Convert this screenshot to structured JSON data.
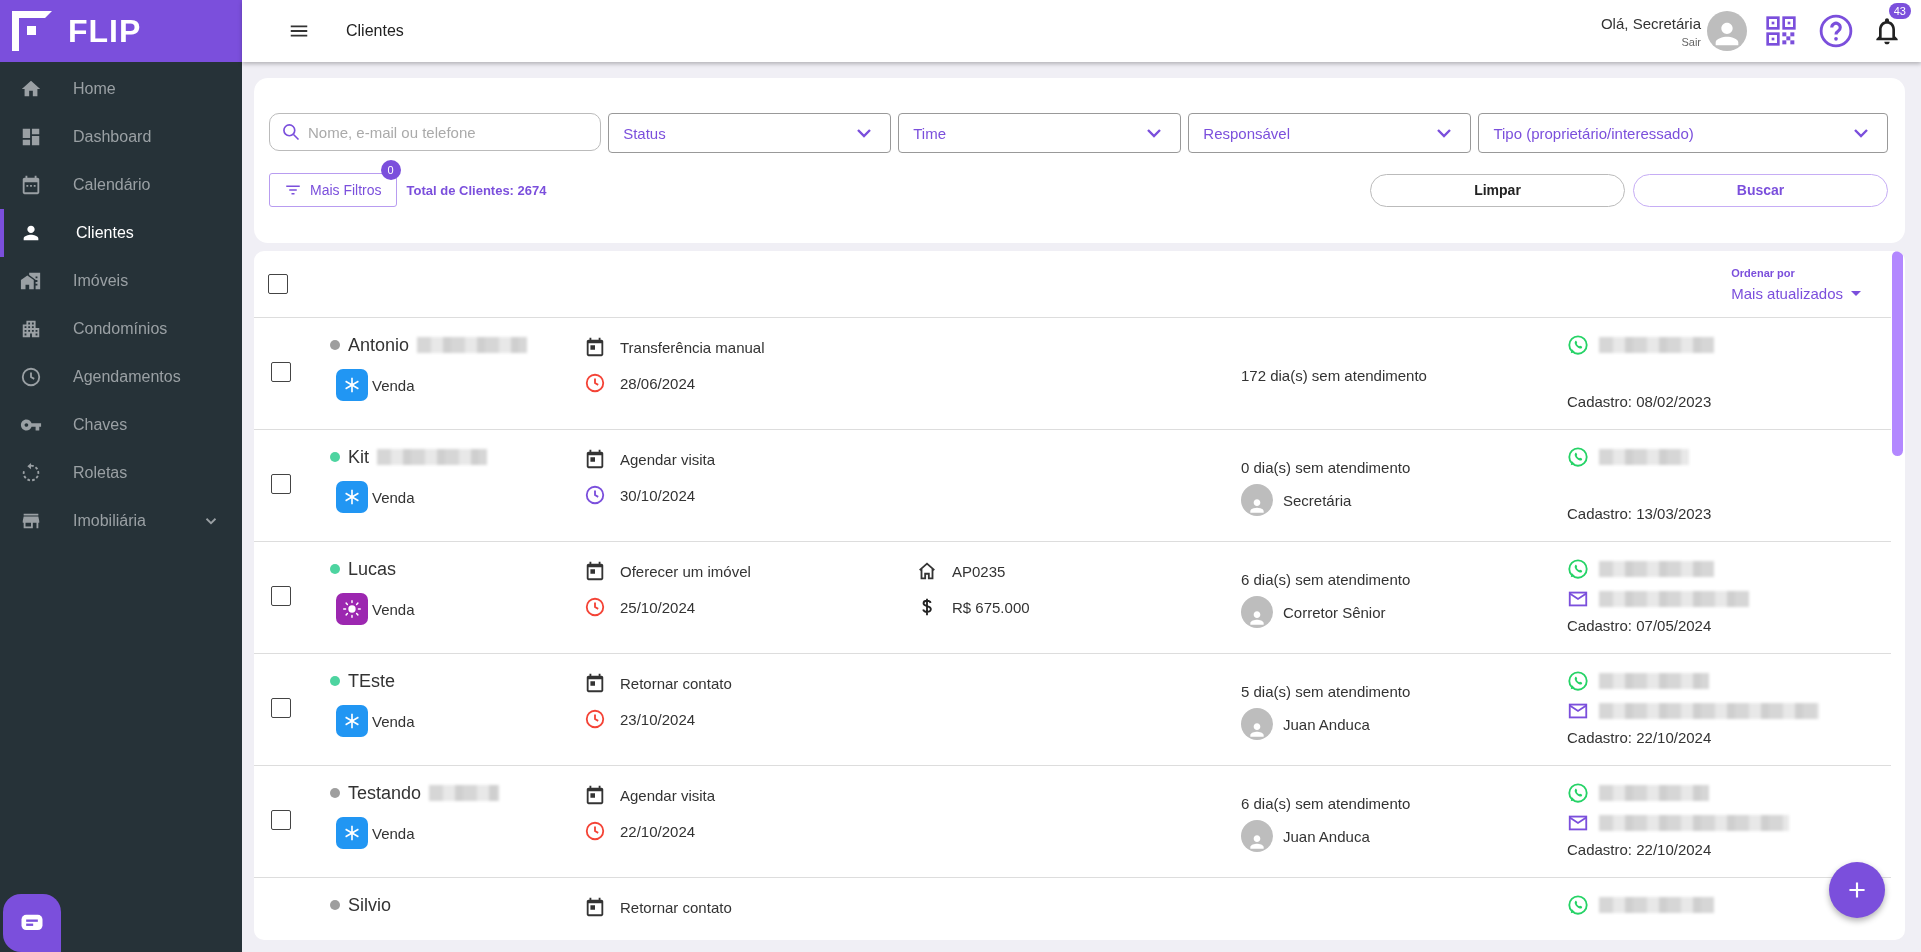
{
  "brand": {
    "name": "FLIP"
  },
  "sidebar": {
    "items": [
      {
        "label": "Home",
        "selected": false
      },
      {
        "label": "Dashboard",
        "selected": false
      },
      {
        "label": "Calendário",
        "selected": false
      },
      {
        "label": "Clientes",
        "selected": true
      },
      {
        "label": "Imóveis",
        "selected": false
      },
      {
        "label": "Condomínios",
        "selected": false
      },
      {
        "label": "Agendamentos",
        "selected": false
      },
      {
        "label": "Chaves",
        "selected": false
      },
      {
        "label": "Roletas",
        "selected": false
      },
      {
        "label": "Imobiliária",
        "selected": false,
        "expanded": false
      }
    ]
  },
  "header": {
    "title": "Clientes",
    "greeting": "Olá, Secretária",
    "logout": "Sair",
    "notifications": "43"
  },
  "filters": {
    "search": {
      "placeholder": "Nome, e-mail ou telefone"
    },
    "selects": [
      {
        "label": "Status"
      },
      {
        "label": "Time"
      },
      {
        "label": "Responsável"
      },
      {
        "label": "Tipo (proprietário/interessado)"
      }
    ],
    "more_filters": {
      "label": "Mais Filtros",
      "count": "0"
    },
    "total": "Total de Clientes: 2674",
    "buttons": [
      {
        "label": "Limpar",
        "kind": "plain"
      },
      {
        "label": "Buscar",
        "kind": "primary"
      }
    ]
  },
  "list": {
    "select_all": {
      "checked": false
    },
    "sort": {
      "label": "Ordenar por",
      "value": "Mais atualizados"
    },
    "rows": [
      {
        "name": "Antonio",
        "name_blurred": true,
        "active": false,
        "checked": false,
        "deal": {
          "label": "Venda",
          "kind": "cold"
        },
        "activity": "Transferência manual",
        "date": "28/06/2024",
        "overdue": true,
        "days": "172 dia(s) sem atendimento",
        "contacts": [
          {
            "kind": "whatsapp"
          }
        ],
        "registered": "Cadastro: 08/02/2023"
      },
      {
        "name": "Kit",
        "name_blurred": true,
        "active": true,
        "checked": false,
        "deal": {
          "label": "Venda",
          "kind": "cold"
        },
        "activity": "Agendar visita",
        "date": "30/10/2024",
        "overdue": false,
        "days": "0 dia(s) sem atendimento",
        "agent": "Secretária",
        "contacts": [
          {
            "kind": "whatsapp"
          }
        ],
        "registered": "Cadastro: 13/03/2023"
      },
      {
        "name": "Lucas",
        "name_blurred": false,
        "active": true,
        "checked": false,
        "deal": {
          "label": "Venda",
          "kind": "hot"
        },
        "activity": "Oferecer um imóvel",
        "date": "25/10/2024",
        "overdue": true,
        "property": {
          "code": "AP0235",
          "price": "R$ 675.000"
        },
        "days": "6 dia(s) sem atendimento",
        "agent": "Corretor Sênior",
        "contacts": [
          {
            "kind": "whatsapp"
          },
          {
            "kind": "email"
          }
        ],
        "registered": "Cadastro: 07/05/2024"
      },
      {
        "name": "TEste",
        "name_blurred": false,
        "active": true,
        "checked": false,
        "deal": {
          "label": "Venda",
          "kind": "cold"
        },
        "activity": "Retornar contato",
        "date": "23/10/2024",
        "overdue": true,
        "days": "5 dia(s) sem atendimento",
        "agent": "Juan Anduca",
        "contacts": [
          {
            "kind": "whatsapp"
          },
          {
            "kind": "email"
          }
        ],
        "registered": "Cadastro: 22/10/2024"
      },
      {
        "name": "Testando",
        "name_blurred": true,
        "active": false,
        "checked": false,
        "deal": {
          "label": "Venda",
          "kind": "cold"
        },
        "activity": "Agendar visita",
        "date": "22/10/2024",
        "overdue": true,
        "days": "6 dia(s) sem atendimento",
        "agent": "Juan Anduca",
        "contacts": [
          {
            "kind": "whatsapp"
          },
          {
            "kind": "email"
          }
        ],
        "registered": "Cadastro: 22/10/2024"
      },
      {
        "name": "Silvio",
        "name_blurred": false,
        "active": false,
        "activity": "Retornar contato",
        "contacts": [
          {
            "kind": "whatsapp"
          }
        ]
      }
    ]
  }
}
